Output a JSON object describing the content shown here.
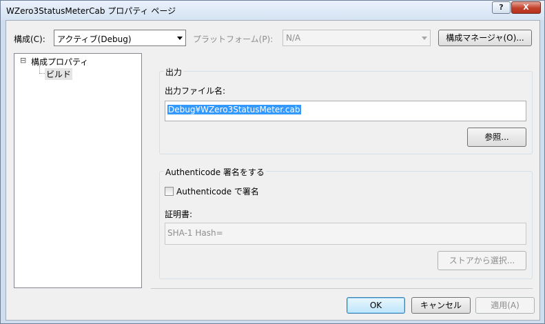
{
  "window": {
    "title": "WZero3StatusMeterCab プロパティ ページ",
    "help_label": "?",
    "close_label": "X"
  },
  "toolbar": {
    "config_label": "構成(C):",
    "config_value": "アクティブ(Debug)",
    "platform_label": "プラットフォーム(P):",
    "platform_value": "N/A",
    "config_manager_label": "構成マネージャ(O)..."
  },
  "tree": {
    "expander": "⊟",
    "root_label": "構成プロパティ",
    "child_label": "ビルド"
  },
  "output_group": {
    "title": "出力",
    "file_label": "出力ファイル名:",
    "file_value": "Debug¥WZero3StatusMeter.cab",
    "browse_label": "参照..."
  },
  "sign_group": {
    "title": "Authenticode 署名をする",
    "checkbox_label": "Authenticode で署名",
    "checked": false,
    "cert_label": "証明書:",
    "cert_value": "SHA-1 Hash=",
    "store_label": "ストアから選択..."
  },
  "footer": {
    "ok_label": "OK",
    "cancel_label": "キャンセル",
    "apply_label": "適用(A)"
  }
}
